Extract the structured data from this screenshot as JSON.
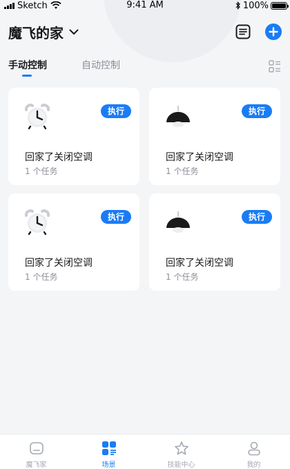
{
  "status_bar": {
    "carrier": "Sketch",
    "time": "9:41 AM",
    "battery": "100%"
  },
  "header": {
    "home_name": "魔飞的家"
  },
  "tabs": [
    {
      "label": "手动控制",
      "active": true
    },
    {
      "label": "自动控制",
      "active": false
    }
  ],
  "cards": [
    {
      "icon": "alarm-clock-icon",
      "execute_label": "执行",
      "title": "回家了关闭空调",
      "subtitle": "1 个任务"
    },
    {
      "icon": "ceiling-lamp-icon",
      "execute_label": "执行",
      "title": "回家了关闭空调",
      "subtitle": "1 个任务"
    },
    {
      "icon": "alarm-clock-icon",
      "execute_label": "执行",
      "title": "回家了关闭空调",
      "subtitle": "1 个任务"
    },
    {
      "icon": "ceiling-lamp-icon",
      "execute_label": "执行",
      "title": "回家了关闭空调",
      "subtitle": "1 个任务"
    }
  ],
  "tabbar": [
    {
      "label": "魔飞家",
      "icon": "home-icon",
      "active": false
    },
    {
      "label": "场景",
      "icon": "scene-icon",
      "active": true
    },
    {
      "label": "技能中心",
      "icon": "star-icon",
      "active": false
    },
    {
      "label": "我的",
      "icon": "person-icon",
      "active": false
    }
  ],
  "colors": {
    "accent": "#1a7cf5",
    "background": "#f4f5f7",
    "card": "#ffffff"
  }
}
